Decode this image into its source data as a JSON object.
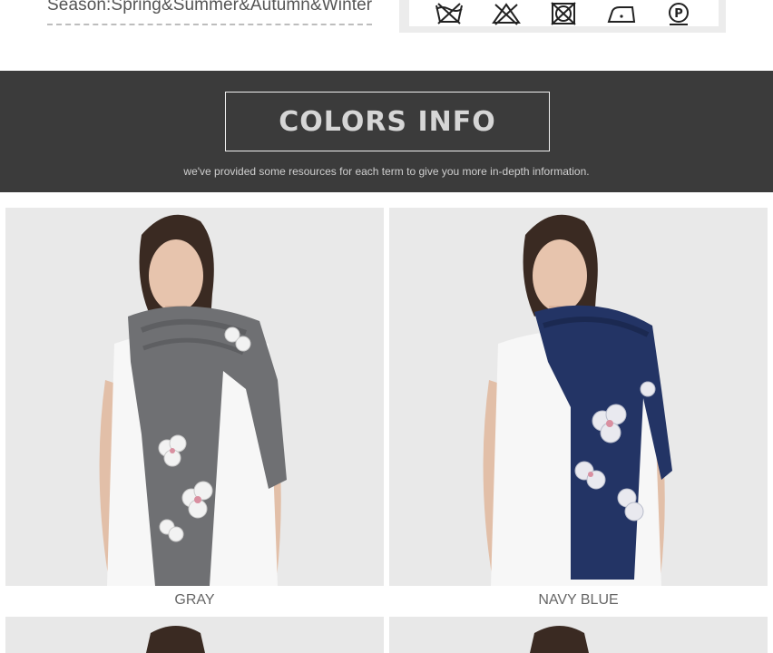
{
  "top": {
    "season_text": "Season:Spring&Summer&Autumn&Winter",
    "care_icons": [
      "do-not-wash-icon",
      "do-not-bleach-icon",
      "do-not-tumble-dry-icon",
      "iron-low-icon",
      "professional-dry-clean-icon"
    ]
  },
  "banner": {
    "title": "COLORS INFO",
    "subtitle": "we've provided some resources for each term to give you more in-depth information."
  },
  "products": [
    {
      "name": "GRAY",
      "scarf_color": "#6f7073"
    },
    {
      "name": "NAVY BLUE",
      "scarf_color": "#233465"
    }
  ],
  "colors": {
    "banner_bg": "#3b3b3b",
    "photo_bg": "#e9e9e9"
  }
}
